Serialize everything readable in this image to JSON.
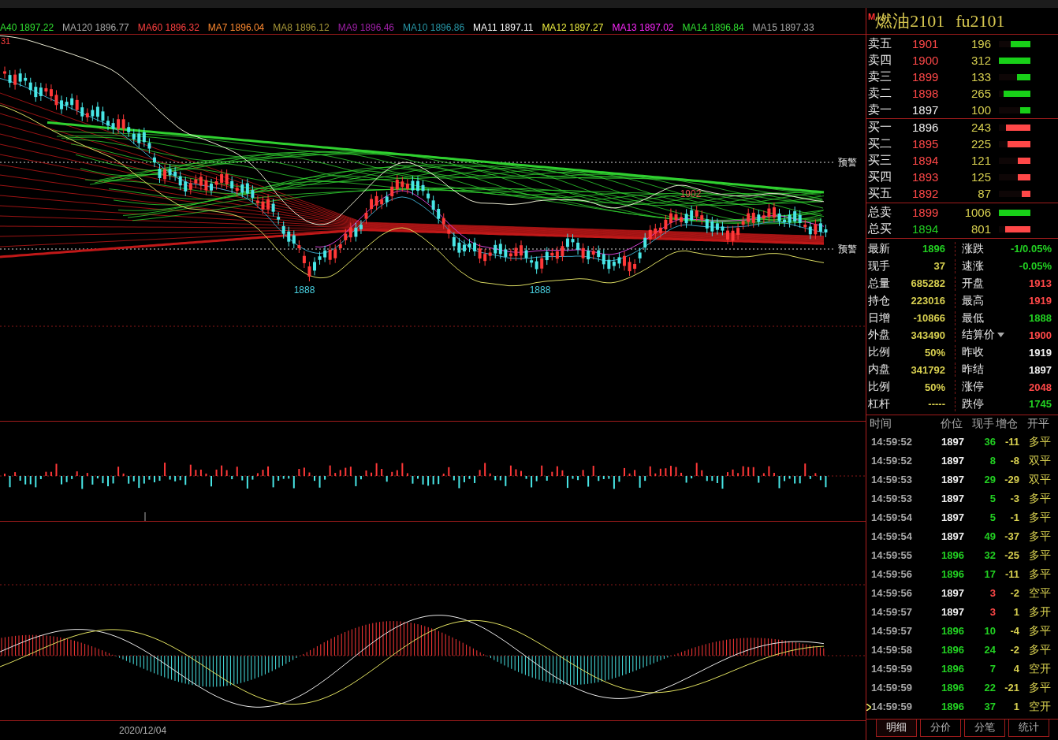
{
  "legend": [
    {
      "label": "A40 1897.22",
      "color": "#30e030"
    },
    {
      "label": "MA120 1896.77",
      "color": "#a8a8a8"
    },
    {
      "label": "MA60 1896.32",
      "color": "#ff4040"
    },
    {
      "label": "MA7 1896.04",
      "color": "#ff8a30"
    },
    {
      "label": "MA8 1896.12",
      "color": "#a89838"
    },
    {
      "label": "MA9 1896.46",
      "color": "#a020a8"
    },
    {
      "label": "MA10 1896.86",
      "color": "#2898a8"
    },
    {
      "label": "MA11 1897.11",
      "color": "#ffffff"
    },
    {
      "label": "MA12 1897.27",
      "color": "#f0f040"
    },
    {
      "label": "MA13 1897.02",
      "color": "#ff28ff"
    },
    {
      "label": "MA14 1896.84",
      "color": "#30e030"
    },
    {
      "label": "MA15 1897.33",
      "color": "#a8a8a8"
    }
  ],
  "main_chart": {
    "corner_label": "31",
    "annotations": [
      {
        "text": "1888",
        "kind": "low"
      },
      {
        "text": "1888",
        "kind": "low"
      },
      {
        "text": "1902",
        "kind": "high"
      }
    ],
    "alerts": [
      "预警",
      "预警"
    ]
  },
  "date_axis": {
    "label": "2020/12/04"
  },
  "quote": {
    "badge": "M",
    "name": "燃油2101",
    "code": "fu2101"
  },
  "book": [
    {
      "label": "卖五",
      "price": "1901",
      "color": "#ff4848",
      "volume": "196",
      "kind": "sell",
      "level": 0.63
    },
    {
      "label": "卖四",
      "price": "1900",
      "color": "#ff4848",
      "volume": "312",
      "kind": "sell",
      "level": 1
    },
    {
      "label": "卖三",
      "price": "1899",
      "color": "#ff4848",
      "volume": "133",
      "kind": "sell",
      "level": 0.43
    },
    {
      "label": "卖二",
      "price": "1898",
      "color": "#ff4848",
      "volume": "265",
      "kind": "sell",
      "level": 0.85
    },
    {
      "label": "卖一",
      "price": "1897",
      "color": "#f0f0f0",
      "volume": "100",
      "kind": "sell",
      "level": 0.32
    },
    {
      "label": "买一",
      "price": "1896",
      "color": "#f0f0f0",
      "volume": "243",
      "kind": "buy",
      "level": 0.78
    },
    {
      "label": "买二",
      "price": "1895",
      "color": "#ff4848",
      "volume": "225",
      "kind": "buy",
      "level": 0.72
    },
    {
      "label": "买三",
      "price": "1894",
      "color": "#ff4848",
      "volume": "121",
      "kind": "buy",
      "level": 0.39
    },
    {
      "label": "买四",
      "price": "1893",
      "color": "#ff4848",
      "volume": "125",
      "kind": "buy",
      "level": 0.4
    },
    {
      "label": "买五",
      "price": "1892",
      "color": "#ff4848",
      "volume": "87",
      "kind": "buy",
      "level": 0.28
    }
  ],
  "totals": [
    {
      "label": "总卖",
      "price": "1899",
      "color": "#ff4848",
      "volume": "1006",
      "kind": "sell",
      "level": 1
    },
    {
      "label": "总买",
      "price": "1894",
      "color": "#22d022",
      "volume": "801",
      "kind": "buy",
      "level": 0.8
    }
  ],
  "stats": [
    {
      "left": {
        "label": "最新",
        "value": "1896",
        "color": "#22d022"
      },
      "right": {
        "label": "涨跌",
        "value": "-1/0.05%",
        "color": "#22d022",
        "dropdown": false
      }
    },
    {
      "left": {
        "label": "现手",
        "value": "37",
        "color": "#d8d050"
      },
      "right": {
        "label": "速涨",
        "value": "-0.05%",
        "color": "#22d022",
        "dropdown": false
      }
    },
    {
      "left": {
        "label": "总量",
        "value": "685282",
        "color": "#d8d050"
      },
      "right": {
        "label": "开盘",
        "value": "1913",
        "color": "#ff4848",
        "dropdown": false
      }
    },
    {
      "left": {
        "label": "持仓",
        "value": "223016",
        "color": "#d8d050"
      },
      "right": {
        "label": "最高",
        "value": "1919",
        "color": "#ff4848",
        "dropdown": false
      }
    },
    {
      "left": {
        "label": "日增",
        "value": "-10866",
        "color": "#d8d050"
      },
      "right": {
        "label": "最低",
        "value": "1888",
        "color": "#22d022",
        "dropdown": false
      }
    },
    {
      "left": {
        "label": "外盘",
        "value": "343490",
        "color": "#d8d050"
      },
      "right": {
        "label": "结算价",
        "value": "1900",
        "color": "#ff4848",
        "dropdown": true
      }
    },
    {
      "left": {
        "label": "比例",
        "value": "50%",
        "color": "#d8d050"
      },
      "right": {
        "label": "昨收",
        "value": "1919",
        "color": "#f0f0f0",
        "dropdown": false
      }
    },
    {
      "left": {
        "label": "内盘",
        "value": "341792",
        "color": "#d8d050"
      },
      "right": {
        "label": "昨结",
        "value": "1897",
        "color": "#f0f0f0",
        "dropdown": false
      }
    },
    {
      "left": {
        "label": "比例",
        "value": "50%",
        "color": "#d8d050"
      },
      "right": {
        "label": "涨停",
        "value": "2048",
        "color": "#ff4848",
        "dropdown": false
      }
    },
    {
      "left": {
        "label": "杠杆",
        "value": "-----",
        "color": "#d8d050"
      },
      "right": {
        "label": "跌停",
        "value": "1745",
        "color": "#22d022",
        "dropdown": false
      }
    }
  ],
  "ticks": {
    "columns": [
      "时间",
      "价位",
      "现手",
      "增仓",
      "开平"
    ],
    "rows": [
      {
        "time": "14:59:52",
        "price": {
          "text": "1897",
          "color": "#f0f0f0"
        },
        "hand": {
          "text": "36",
          "color": "#22d022"
        },
        "change": "-11",
        "type": "多平",
        "selected": false
      },
      {
        "time": "14:59:52",
        "price": {
          "text": "1897",
          "color": "#f0f0f0"
        },
        "hand": {
          "text": "8",
          "color": "#22d022"
        },
        "change": "-8",
        "type": "双平",
        "selected": false
      },
      {
        "time": "14:59:53",
        "price": {
          "text": "1897",
          "color": "#f0f0f0"
        },
        "hand": {
          "text": "29",
          "color": "#22d022"
        },
        "change": "-29",
        "type": "双平",
        "selected": false
      },
      {
        "time": "14:59:53",
        "price": {
          "text": "1897",
          "color": "#f0f0f0"
        },
        "hand": {
          "text": "5",
          "color": "#22d022"
        },
        "change": "-3",
        "type": "多平",
        "selected": false
      },
      {
        "time": "14:59:54",
        "price": {
          "text": "1897",
          "color": "#f0f0f0"
        },
        "hand": {
          "text": "5",
          "color": "#22d022"
        },
        "change": "-1",
        "type": "多平",
        "selected": false
      },
      {
        "time": "14:59:54",
        "price": {
          "text": "1897",
          "color": "#f0f0f0"
        },
        "hand": {
          "text": "49",
          "color": "#22d022"
        },
        "change": "-37",
        "type": "多平",
        "selected": false
      },
      {
        "time": "14:59:55",
        "price": {
          "text": "1896",
          "color": "#22d022"
        },
        "hand": {
          "text": "32",
          "color": "#22d022"
        },
        "change": "-25",
        "type": "多平",
        "selected": false
      },
      {
        "time": "14:59:56",
        "price": {
          "text": "1896",
          "color": "#22d022"
        },
        "hand": {
          "text": "17",
          "color": "#22d022"
        },
        "change": "-11",
        "type": "多平",
        "selected": false
      },
      {
        "time": "14:59:56",
        "price": {
          "text": "1897",
          "color": "#f0f0f0"
        },
        "hand": {
          "text": "3",
          "color": "#ff4848"
        },
        "change": "-2",
        "type": "空平",
        "selected": false
      },
      {
        "time": "14:59:57",
        "price": {
          "text": "1897",
          "color": "#f0f0f0"
        },
        "hand": {
          "text": "3",
          "color": "#ff4848"
        },
        "change": "1",
        "type": "多开",
        "selected": false
      },
      {
        "time": "14:59:57",
        "price": {
          "text": "1896",
          "color": "#22d022"
        },
        "hand": {
          "text": "10",
          "color": "#22d022"
        },
        "change": "-4",
        "type": "多平",
        "selected": false
      },
      {
        "time": "14:59:58",
        "price": {
          "text": "1896",
          "color": "#22d022"
        },
        "hand": {
          "text": "24",
          "color": "#22d022"
        },
        "change": "-2",
        "type": "多平",
        "selected": false
      },
      {
        "time": "14:59:59",
        "price": {
          "text": "1896",
          "color": "#22d022"
        },
        "hand": {
          "text": "7",
          "color": "#22d022"
        },
        "change": "4",
        "type": "空开",
        "selected": false
      },
      {
        "time": "14:59:59",
        "price": {
          "text": "1896",
          "color": "#22d022"
        },
        "hand": {
          "text": "22",
          "color": "#22d022"
        },
        "change": "-21",
        "type": "多平",
        "selected": false
      },
      {
        "time": "14:59:59",
        "price": {
          "text": "1896",
          "color": "#22d022"
        },
        "hand": {
          "text": "37",
          "color": "#22d022"
        },
        "change": "1",
        "type": "空开",
        "selected": true
      }
    ]
  },
  "tabs": [
    {
      "label": "明细",
      "selected": true
    },
    {
      "label": "分价",
      "selected": false
    },
    {
      "label": "分笔",
      "selected": false
    },
    {
      "label": "统计",
      "selected": false
    }
  ]
}
